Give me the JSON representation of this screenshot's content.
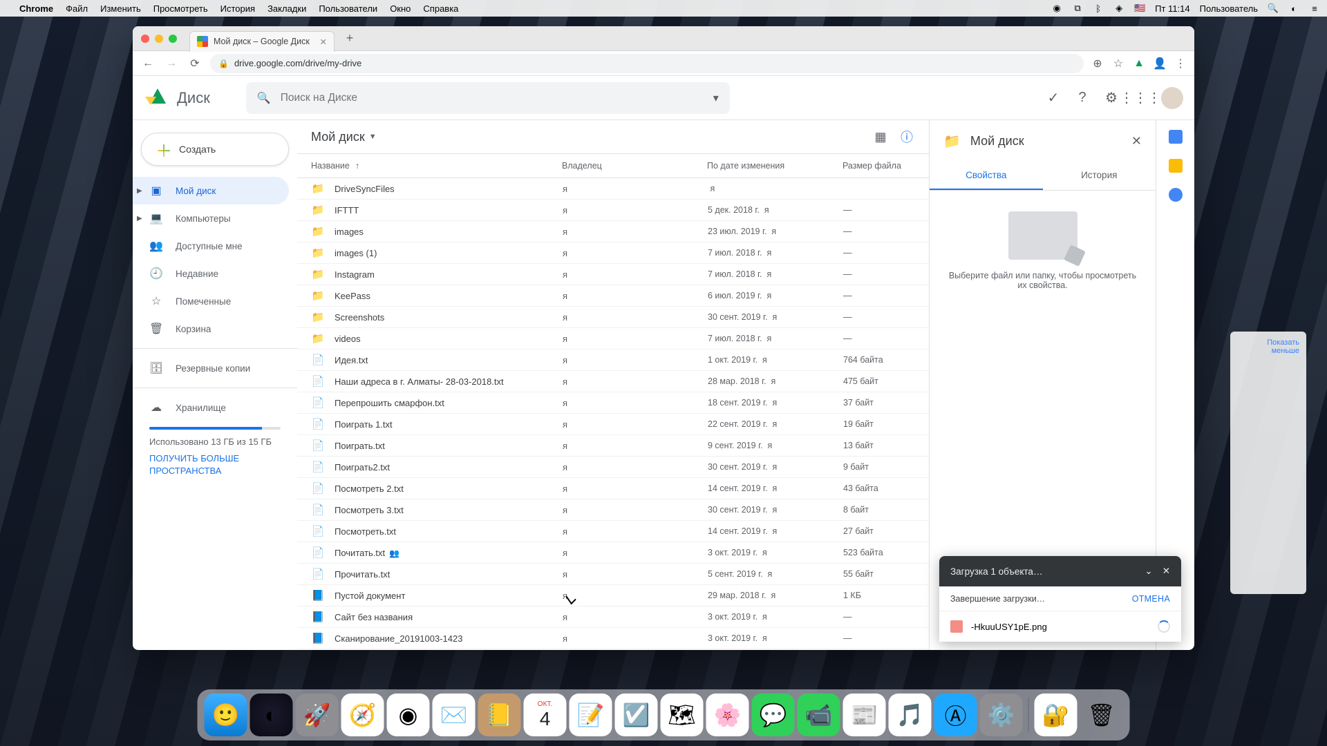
{
  "menubar": {
    "app": "Chrome",
    "items": [
      "Файл",
      "Изменить",
      "Просмотреть",
      "История",
      "Закладки",
      "Пользователи",
      "Окно",
      "Справка"
    ],
    "clock": "Пт 11:14",
    "user": "Пользователь"
  },
  "tab": {
    "title": "Мой диск – Google Диск"
  },
  "url": "drive.google.com/drive/my-drive",
  "drive": {
    "brand": "Диск",
    "search_placeholder": "Поиск на Диске",
    "create": "Создать",
    "sidebar": [
      {
        "icon": "drive",
        "label": "Мой диск",
        "active": true,
        "expand": true
      },
      {
        "icon": "devices",
        "label": "Компьютеры",
        "expand": true
      },
      {
        "icon": "people",
        "label": "Доступные мне"
      },
      {
        "icon": "clock",
        "label": "Недавние"
      },
      {
        "icon": "star",
        "label": "Помеченные"
      },
      {
        "icon": "trash",
        "label": "Корзина"
      }
    ],
    "backups_label": "Резервные копии",
    "storage_label": "Хранилище",
    "storage_text": "Использовано 13 ГБ из 15 ГБ",
    "storage_cta": "ПОЛУЧИТЬ БОЛЬШЕ ПРОСТРАНСТВА",
    "breadcrumb": "Мой диск",
    "columns": {
      "name": "Название",
      "owner": "Владелец",
      "date": "По дате изменения",
      "size": "Размер файла"
    },
    "files": [
      {
        "type": "folder",
        "name": "DriveSyncFiles",
        "owner": "я",
        "date": "",
        "date_suffix": "я",
        "size": ""
      },
      {
        "type": "folder",
        "name": "IFTTT",
        "owner": "я",
        "date": "5 дек. 2018 г.",
        "date_suffix": "я",
        "size": "—"
      },
      {
        "type": "folder",
        "name": "images",
        "owner": "я",
        "date": "23 июл. 2019 г.",
        "date_suffix": "я",
        "size": "—"
      },
      {
        "type": "folder",
        "name": "images (1)",
        "owner": "я",
        "date": "7 июл. 2018 г.",
        "date_suffix": "я",
        "size": "—"
      },
      {
        "type": "folder",
        "name": "Instagram",
        "owner": "я",
        "date": "7 июл. 2018 г.",
        "date_suffix": "я",
        "size": "—"
      },
      {
        "type": "folder",
        "name": "KeePass",
        "owner": "я",
        "date": "6 июл. 2019 г.",
        "date_suffix": "я",
        "size": "—"
      },
      {
        "type": "folder",
        "name": "Screenshots",
        "owner": "я",
        "date": "30 сент. 2019 г.",
        "date_suffix": "я",
        "size": "—"
      },
      {
        "type": "folder",
        "name": "videos",
        "owner": "я",
        "date": "7 июл. 2018 г.",
        "date_suffix": "я",
        "size": "—"
      },
      {
        "type": "doc",
        "name": "Идея.txt",
        "owner": "я",
        "date": "1 окт. 2019 г.",
        "date_suffix": "я",
        "size": "764 байта"
      },
      {
        "type": "doc",
        "name": "Наши адреса в г. Алматы- 28-03-2018.txt",
        "owner": "я",
        "date": "28 мар. 2018 г.",
        "date_suffix": "я",
        "size": "475 байт"
      },
      {
        "type": "doc",
        "name": "Перепрошить смарфон.txt",
        "owner": "я",
        "date": "18 сент. 2019 г.",
        "date_suffix": "я",
        "size": "37 байт"
      },
      {
        "type": "doc",
        "name": "Поиграть 1.txt",
        "owner": "я",
        "date": "22 сент. 2019 г.",
        "date_suffix": "я",
        "size": "19 байт"
      },
      {
        "type": "doc",
        "name": "Поиграть.txt",
        "owner": "я",
        "date": "9 сент. 2019 г.",
        "date_suffix": "я",
        "size": "13 байт"
      },
      {
        "type": "doc",
        "name": "Поиграть2.txt",
        "owner": "я",
        "date": "30 сент. 2019 г.",
        "date_suffix": "я",
        "size": "9 байт"
      },
      {
        "type": "doc",
        "name": "Посмотреть 2.txt",
        "owner": "я",
        "date": "14 сент. 2019 г.",
        "date_suffix": "я",
        "size": "43 байта"
      },
      {
        "type": "doc",
        "name": "Посмотреть 3.txt",
        "owner": "я",
        "date": "30 сент. 2019 г.",
        "date_suffix": "я",
        "size": "8 байт"
      },
      {
        "type": "doc",
        "name": "Посмотреть.txt",
        "owner": "я",
        "date": "14 сент. 2019 г.",
        "date_suffix": "я",
        "size": "27 байт"
      },
      {
        "type": "doc",
        "name": "Почитать.txt",
        "owner": "я",
        "date": "3 окт. 2019 г.",
        "date_suffix": "я",
        "size": "523 байта",
        "shared": true
      },
      {
        "type": "doc",
        "name": "Прочитать.txt",
        "owner": "я",
        "date": "5 сент. 2019 г.",
        "date_suffix": "я",
        "size": "55 байт"
      },
      {
        "type": "gdoc",
        "name": "Пустой документ",
        "owner": "я",
        "date": "29 мар. 2018 г.",
        "date_suffix": "я",
        "size": "1 КБ"
      },
      {
        "type": "gdoc",
        "name": "Сайт без названия",
        "owner": "я",
        "date": "3 окт. 2019 г.",
        "date_suffix": "я",
        "size": "—"
      },
      {
        "type": "gdoc",
        "name": "Сканирование_20191003-1423",
        "owner": "я",
        "date": "3 окт. 2019 г.",
        "date_suffix": "я",
        "size": "—"
      }
    ],
    "details": {
      "title": "Мой диск",
      "tab_props": "Свойства",
      "tab_history": "История",
      "hint": "Выберите файл или папку, чтобы просмотреть их свойства."
    },
    "upload": {
      "title": "Загрузка 1 объекта…",
      "status": "Завершение загрузки…",
      "cancel": "ОТМЕНА",
      "file": "-HkuuUSY1pE.png"
    }
  },
  "calendar": {
    "month": "ОКТ.",
    "day": "4"
  },
  "desk_widget_link": "Показать меньше"
}
